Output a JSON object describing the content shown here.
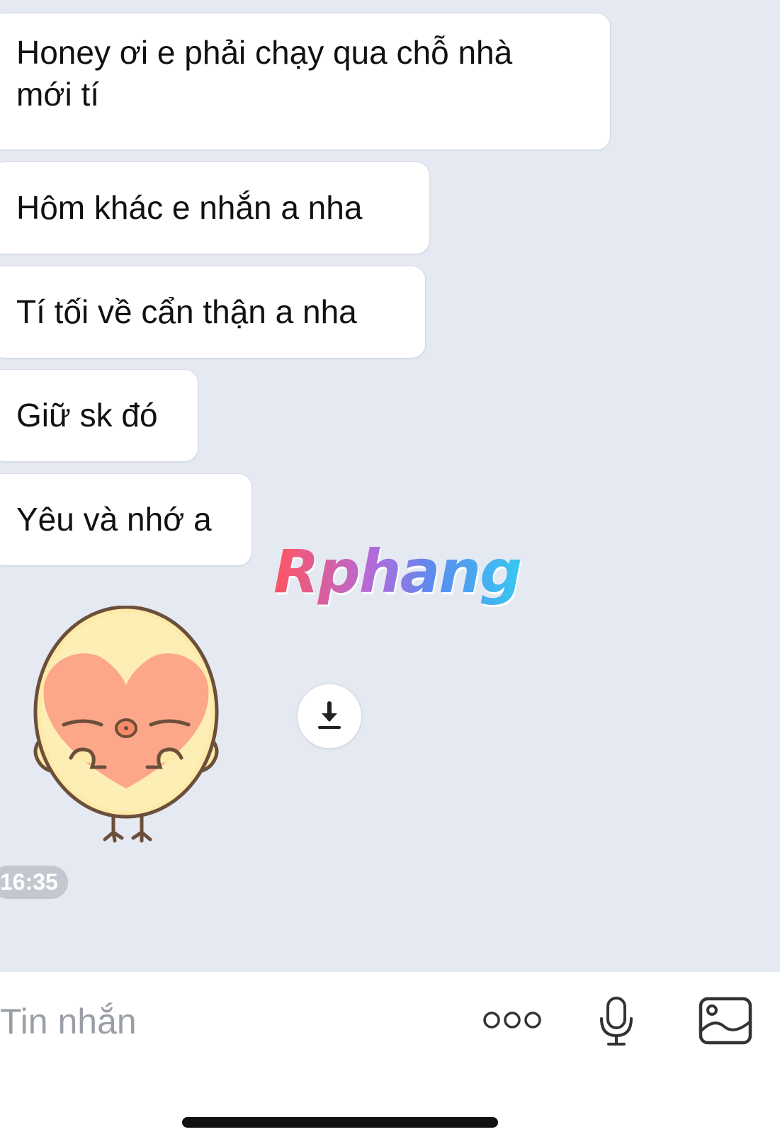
{
  "messages": [
    {
      "lines": [
        "Honey ơi e phải chạy qua chỗ nhà",
        "mới tí"
      ]
    },
    {
      "lines": [
        "Hôm khác e nhắn a nha"
      ]
    },
    {
      "lines": [
        "Tí tối về cẩn thận a nha"
      ]
    },
    {
      "lines": [
        "Giữ sk đó"
      ]
    },
    {
      "lines": [
        "Yêu và nhớ a"
      ]
    }
  ],
  "watermark": "Rphang",
  "sticker": {
    "icon": "heart-chick-sticker"
  },
  "download": {
    "icon": "download-icon"
  },
  "timestamp": "16:35",
  "composer": {
    "placeholder": "Tin nhắn",
    "value": "",
    "more_icon": "more-options-icon",
    "mic_icon": "microphone-icon",
    "gallery_icon": "image-gallery-icon"
  },
  "colors": {
    "chat_background": "#e4e9f2",
    "bubble": "#ffffff",
    "timestamp_badge": "#c3c8d0",
    "text": "#111111"
  }
}
